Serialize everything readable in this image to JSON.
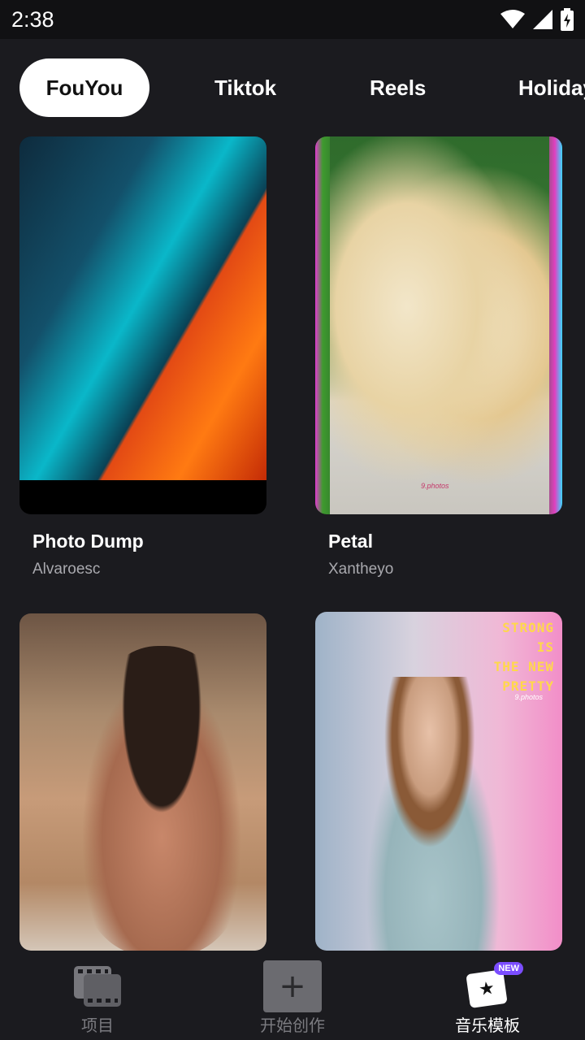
{
  "status_bar": {
    "time": "2:38",
    "icons": [
      "wifi-icon",
      "cellular-signal-icon",
      "battery-charging-icon"
    ]
  },
  "tabs": [
    {
      "label": "FouYou",
      "active": true
    },
    {
      "label": "Tiktok",
      "active": false
    },
    {
      "label": "Reels",
      "active": false
    },
    {
      "label": "Holiday",
      "active": false
    }
  ],
  "templates": [
    {
      "title": "Photo Dump",
      "author": "Alvaroesc"
    },
    {
      "title": "Petal",
      "author": "Xantheyo"
    },
    {
      "title": "",
      "author": ""
    },
    {
      "title": "",
      "author": ""
    }
  ],
  "overlay": {
    "lines": [
      "STRONG",
      "IS",
      "THE NEW",
      "PRETTY"
    ],
    "watermark": "9.photos",
    "watermark_b": "9.photos"
  },
  "bottom_nav": {
    "projects_label": "项目",
    "create_label": "开始创作",
    "create_symbol": "+",
    "templates_label": "音乐模板",
    "new_badge": "NEW",
    "active": "templates"
  },
  "colors": {
    "background": "#1b1b1f",
    "active_tab_bg": "#ffffff",
    "badge": "#7b4dff",
    "overlay_text": "#ffd84a"
  }
}
